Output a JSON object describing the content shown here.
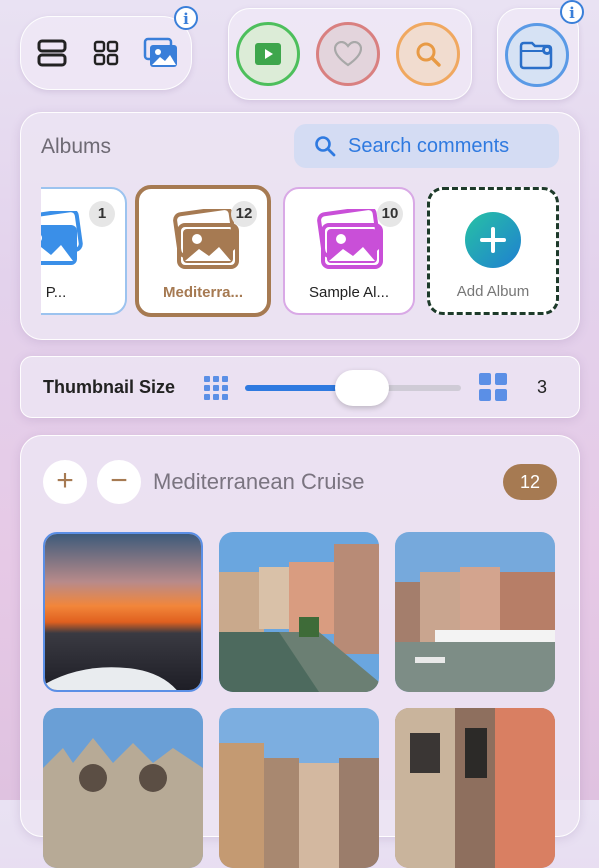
{
  "toolbar": {
    "view_modes": [
      "list-view",
      "grid-view",
      "album-view"
    ],
    "info_label": "i",
    "actions": [
      "play",
      "favorite",
      "search"
    ],
    "settings": "folder-settings"
  },
  "albums_panel": {
    "title": "Albums",
    "search_label": "Search comments",
    "albums": [
      {
        "label": "ation P...",
        "count": "1",
        "color": "#3a8fe8"
      },
      {
        "label": "Mediterra...",
        "count": "12",
        "color": "#a67a52"
      },
      {
        "label": "Sample Al...",
        "count": "10",
        "color": "#c94fd8"
      }
    ],
    "add_album_label": "Add Album"
  },
  "thumbnail": {
    "label": "Thumbnail Size",
    "value": "3",
    "slider_fraction": 0.54
  },
  "album_view": {
    "plus_label": "+",
    "minus_label": "−",
    "title": "Mediterranean Cruise",
    "count": "12"
  },
  "colors": {
    "accent_blue": "#3a7fd9",
    "brown": "#a67a52",
    "play_green": "#4dbf5c",
    "heart_red": "#d98080",
    "search_orange": "#f0a860"
  }
}
